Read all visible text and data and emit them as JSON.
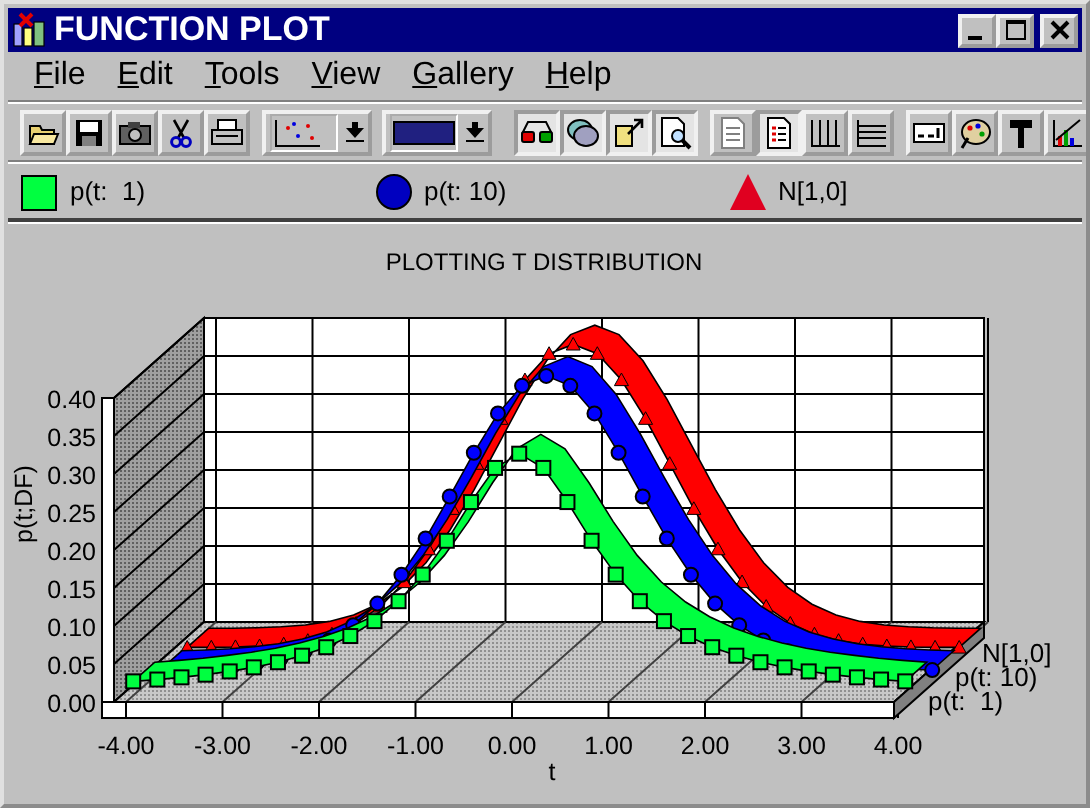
{
  "window": {
    "title": "FUNCTION PLOT"
  },
  "menu": [
    {
      "label": "File"
    },
    {
      "label": "Edit"
    },
    {
      "label": "Tools"
    },
    {
      "label": "View"
    },
    {
      "label": "Gallery"
    },
    {
      "label": "Help"
    }
  ],
  "toolbar": {
    "groups": [
      [
        {
          "kind": "button",
          "pressed": false
        },
        {
          "kind": "button",
          "pressed": false
        },
        {
          "kind": "button",
          "pressed": false
        },
        {
          "kind": "button",
          "pressed": false
        },
        {
          "kind": "button",
          "pressed": false
        }
      ],
      [
        {
          "kind": "dropdown",
          "pressed": false
        },
        {
          "kind": "dropdown",
          "pressed": false
        }
      ],
      [
        {
          "kind": "button",
          "pressed": true
        },
        {
          "kind": "button",
          "pressed": true
        },
        {
          "kind": "button",
          "pressed": true
        },
        {
          "kind": "button",
          "pressed": true
        }
      ],
      [
        {
          "kind": "button",
          "pressed": false
        },
        {
          "kind": "button",
          "pressed": true
        },
        {
          "kind": "button",
          "pressed": false
        },
        {
          "kind": "button",
          "pressed": false
        }
      ],
      [
        {
          "kind": "button",
          "pressed": false
        },
        {
          "kind": "button",
          "pressed": false
        },
        {
          "kind": "button",
          "pressed": false
        },
        {
          "kind": "button",
          "pressed": false
        }
      ]
    ]
  },
  "legend": [
    {
      "label": "p(t:  1)",
      "kind": "square",
      "color": "#00ff40"
    },
    {
      "label": "p(t: 10)",
      "kind": "circle",
      "color": "#0000c0"
    },
    {
      "label": "N[1,0]",
      "kind": "triangle",
      "color": "#e00020"
    }
  ],
  "chart": {
    "title": "PLOTTING T DISTRIBUTION",
    "xlabel": "t",
    "ylabel": "p(t;DF)",
    "xticks": [
      "-4.00",
      "-3.00",
      "-2.00",
      "-1.00",
      "0.00",
      "1.00",
      "2.00",
      "3.00",
      "4.00"
    ],
    "yticks": [
      "0.40",
      "0.35",
      "0.30",
      "0.25",
      "0.20",
      "0.15",
      "0.10",
      "0.05",
      "0.00"
    ],
    "series": [
      {
        "name": "p(t:  1)",
        "kind": "square",
        "color": "#00ff40"
      },
      {
        "name": "p(t: 10)",
        "kind": "circle",
        "color": "#0000ff"
      },
      {
        "name": "N[1,0]",
        "kind": "triangle",
        "color": "#ff0000"
      }
    ]
  }
}
